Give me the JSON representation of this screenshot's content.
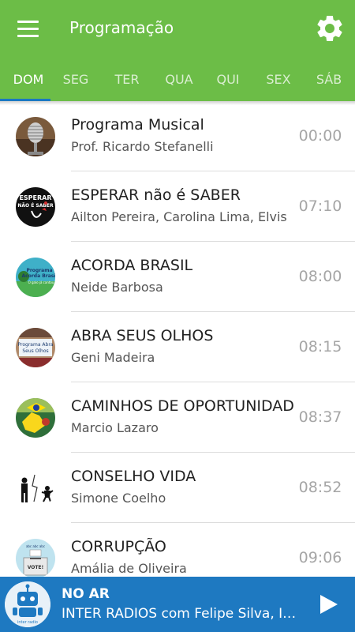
{
  "app": {
    "title": "Programação",
    "menu_icon": "hamburger-menu-icon",
    "settings_icon": "gear-icon",
    "brand_color": "#6cbd47",
    "accent_color": "#1a78c2"
  },
  "tabs": [
    {
      "label": "DOM",
      "active": true
    },
    {
      "label": "SEG",
      "active": false
    },
    {
      "label": "TER",
      "active": false
    },
    {
      "label": "QUA",
      "active": false
    },
    {
      "label": "QUI",
      "active": false
    },
    {
      "label": "SEX",
      "active": false
    },
    {
      "label": "SÁB",
      "active": false
    }
  ],
  "programs": [
    {
      "name": "Programa Musical",
      "host": "Prof. Ricardo Stefanelli",
      "time": "00:00",
      "thumb_icon": "vintage-microphone-icon"
    },
    {
      "name": "ESPERAR não é SABER",
      "host": "Ailton Pereira, Carolina Lima, Elvis",
      "time": "07:10",
      "thumb_icon": "esperar-nao-e-saber-logo",
      "thumb_text": "ESPERAR NÃO É SABER"
    },
    {
      "name": "ACORDA BRASIL",
      "host": "Neide Barbosa",
      "time": "08:00",
      "thumb_icon": "acorda-brasil-logo",
      "thumb_text": "Programa Acorda Brasil"
    },
    {
      "name": "ABRA SEUS OLHOS",
      "host": "Geni Madeira",
      "time": "08:15",
      "thumb_icon": "abra-seus-olhos-logo",
      "thumb_text": "Programa Abra Seus Olhos"
    },
    {
      "name": "CAMINHOS DE OPORTUNIDADES",
      "host": "Marcio Lazaro",
      "time": "08:37",
      "thumb_icon": "brazil-flag-map-icon"
    },
    {
      "name": "CONSELHO VIDA",
      "host": "Simone Coelho",
      "time": "08:52",
      "thumb_icon": "people-figures-icon"
    },
    {
      "name": "CORRUPÇÃO",
      "host": "Amália de Oliveira",
      "time": "09:06",
      "thumb_icon": "ballot-box-vote-icon",
      "thumb_text": "VOTE!"
    }
  ],
  "player": {
    "status": "NO AR",
    "now_playing": "INTER RADIOS com Felipe Silva, Isabela",
    "logo_icon": "inter-radio-robot-logo",
    "play_icon": "play-icon",
    "color": "#1e79c1"
  }
}
